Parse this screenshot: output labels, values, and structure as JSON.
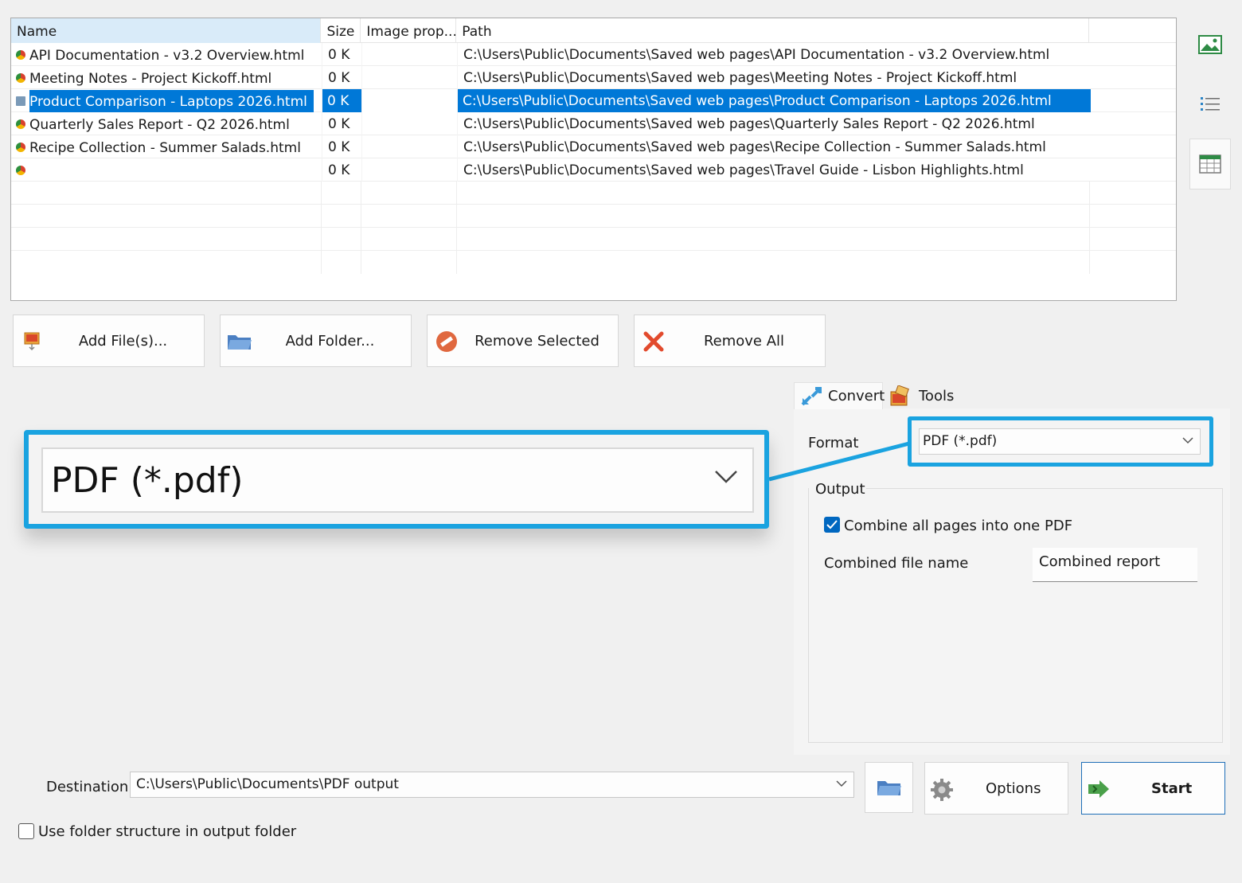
{
  "file_list": {
    "columns": [
      "Name",
      "Size",
      "Image prop...",
      "Path"
    ],
    "rows": [
      {
        "name": "API Documentation - v3.2 Overview.html",
        "size": "0 K",
        "image_prop": "",
        "path": "C:\\Users\\Public\\Documents\\Saved web pages\\API Documentation - v3.2 Overview.html"
      },
      {
        "name": "Meeting Notes - Project Kickoff.html",
        "size": "0 K",
        "image_prop": "",
        "path": "C:\\Users\\Public\\Documents\\Saved web pages\\Meeting Notes - Project Kickoff.html"
      },
      {
        "name": "Product Comparison - Laptops 2026.html",
        "size": "0 K",
        "image_prop": "",
        "path": "C:\\Users\\Public\\Documents\\Saved web pages\\Product Comparison - Laptops 2026.html",
        "selected": true
      },
      {
        "name": "Quarterly Sales Report - Q2 2026.html",
        "size": "0 K",
        "image_prop": "",
        "path": "C:\\Users\\Public\\Documents\\Saved web pages\\Quarterly Sales Report - Q2 2026.html"
      },
      {
        "name": "Recipe Collection - Summer Salads.html",
        "size": "0 K",
        "image_prop": "",
        "path": "C:\\Users\\Public\\Documents\\Saved web pages\\Recipe Collection - Summer Salads.html"
      },
      {
        "name": "",
        "size": "0 K",
        "image_prop": "",
        "path": "C:\\Users\\Public\\Documents\\Saved web pages\\Travel Guide - Lisbon Highlights.html"
      }
    ]
  },
  "side_icons": [
    "thumbnail-view-icon",
    "list-view-icon",
    "details-view-icon"
  ],
  "actions": {
    "add_files": "Add File(s)...",
    "add_folder": "Add Folder...",
    "remove_selected": "Remove Selected",
    "remove_all": "Remove All"
  },
  "tabs": {
    "convert": "Convert",
    "tools": "Tools"
  },
  "format": {
    "label": "Format",
    "value": "PDF (*.pdf)"
  },
  "output": {
    "legend": "Output",
    "combine_label": "Combine all pages into one PDF",
    "combine_checked": true,
    "combined_name_label": "Combined file name",
    "combined_name_value": "Combined report"
  },
  "destination": {
    "label": "Destination",
    "value": "C:\\Users\\Public\\Documents\\PDF output"
  },
  "options_label": "Options",
  "start_label": "Start",
  "use_folder_structure_label": "Use folder structure in output folder",
  "use_folder_structure_checked": false,
  "colors": {
    "selection": "#0078d7",
    "highlight": "#1aa3e0",
    "start_border": "#1f6fb8"
  }
}
